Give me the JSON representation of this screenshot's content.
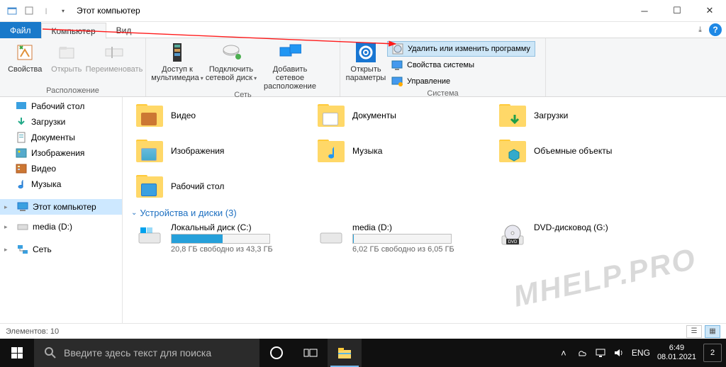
{
  "window": {
    "title": "Этот компьютер"
  },
  "tabs": {
    "file": "Файл",
    "computer": "Компьютер",
    "view": "Вид"
  },
  "ribbon": {
    "location": {
      "label": "Расположение",
      "properties": "Свойства",
      "open": "Открыть",
      "rename": "Переименовать"
    },
    "network": {
      "label": "Сеть",
      "media_access": "Доступ к\nмультимедиа",
      "map_drive": "Подключить\nсетевой диск",
      "add_location": "Добавить сетевое\nрасположение"
    },
    "system": {
      "label": "Система",
      "open_settings": "Открыть\nпараметры",
      "uninstall": "Удалить или изменить программу",
      "sys_properties": "Свойства системы",
      "manage": "Управление"
    }
  },
  "sidebar": {
    "desktop": "Рабочий стол",
    "downloads": "Загрузки",
    "documents": "Документы",
    "pictures": "Изображения",
    "video": "Видео",
    "music": "Музыка",
    "this_pc": "Этот компьютер",
    "media": "media (D:)",
    "network": "Сеть"
  },
  "folders": {
    "video": "Видео",
    "documents": "Документы",
    "downloads": "Загрузки",
    "pictures": "Изображения",
    "music": "Музыка",
    "objects3d": "Объемные объекты",
    "desktop": "Рабочий стол"
  },
  "drives": {
    "header": "Устройства и диски (3)",
    "local": {
      "name": "Локальный диск (C:)",
      "sub": "20,8 ГБ свободно из 43,3 ГБ",
      "pct": 52
    },
    "media": {
      "name": "media (D:)",
      "sub": "6,02 ГБ свободно из 6,05 ГБ",
      "pct": 1
    },
    "dvd": {
      "name": "DVD-дисковод (G:)"
    }
  },
  "statusbar": {
    "items": "Элементов: 10"
  },
  "taskbar": {
    "search_placeholder": "Введите здесь текст для поиска",
    "lang": "ENG",
    "time": "6:49",
    "date": "08.01.2021",
    "notif_count": "2"
  },
  "watermark": "MHELP.PRO"
}
